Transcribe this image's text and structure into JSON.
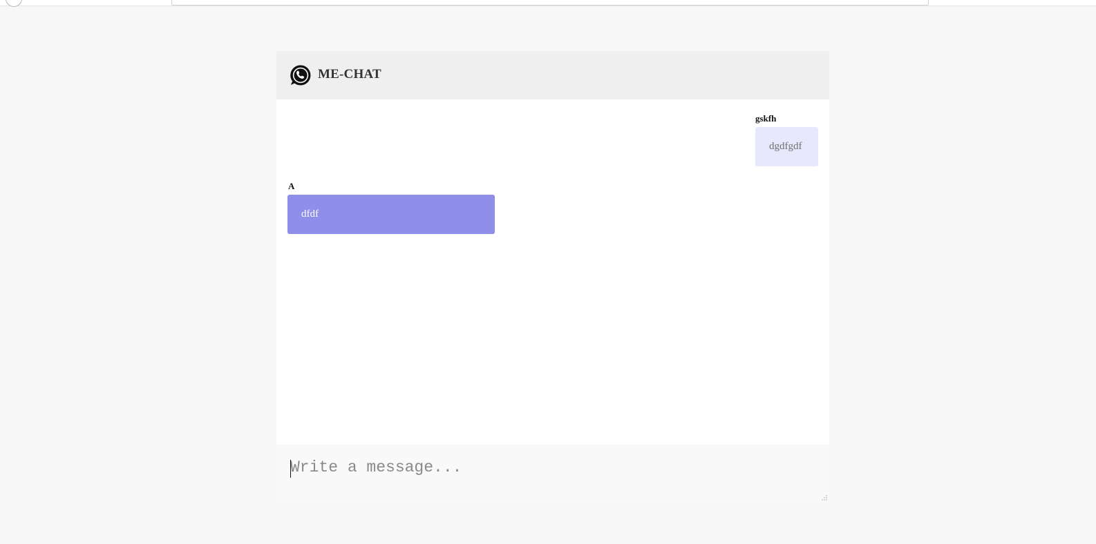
{
  "app": {
    "title": "ME-CHAT",
    "logo_icon": "whatsapp-phone-icon"
  },
  "messages": [
    {
      "sender": "gskfh",
      "text": "dgdfgdf",
      "side": "right",
      "color": "#e8e8fc"
    },
    {
      "sender": "A",
      "text": "dfdf",
      "side": "left",
      "color": "#8f8ee8"
    }
  ],
  "composer": {
    "placeholder": "Write a message...",
    "value": ""
  }
}
